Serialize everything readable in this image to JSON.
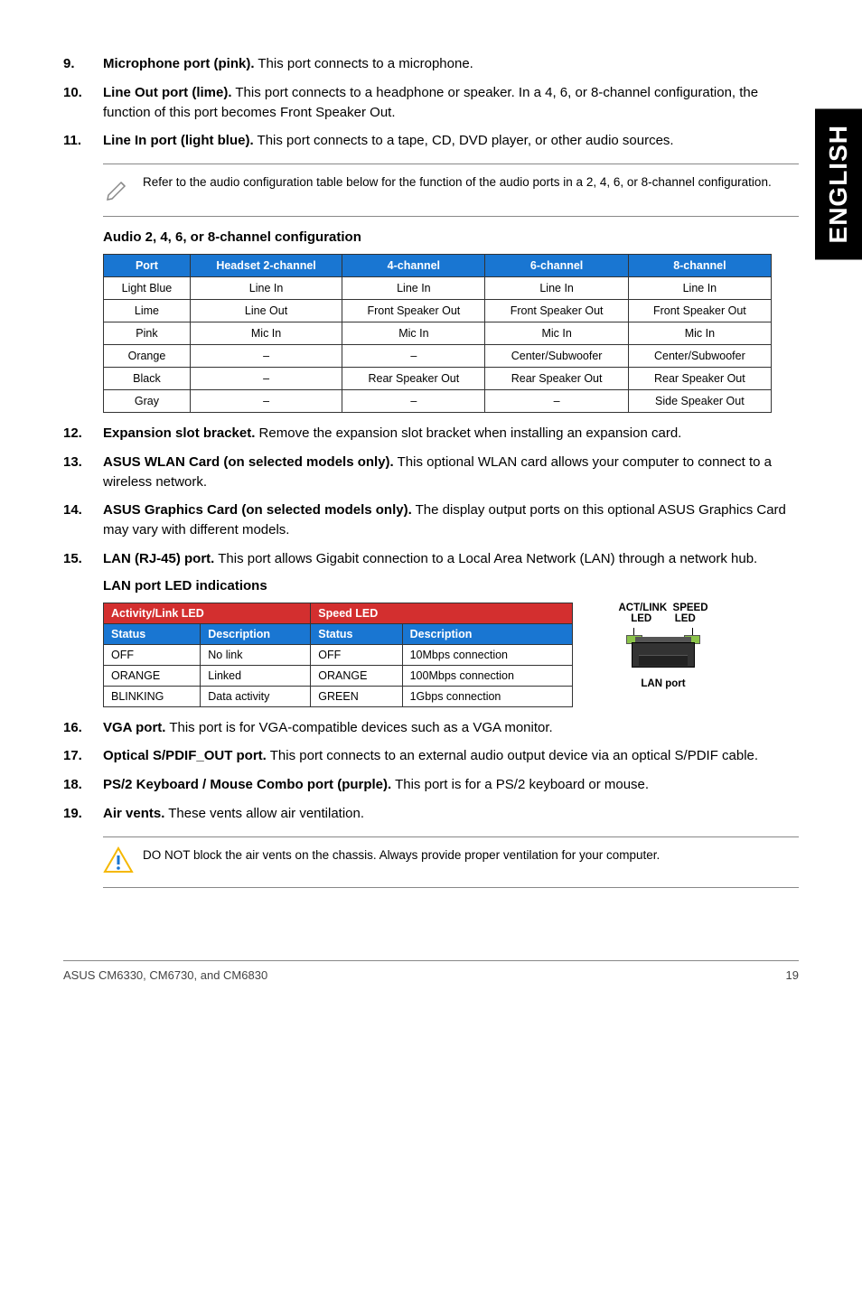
{
  "sideTab": "ENGLISH",
  "items9_11": [
    {
      "n": "9.",
      "bold": "Microphone port (pink).",
      "rest": " This port connects to a microphone."
    },
    {
      "n": "10.",
      "bold": "Line Out port (lime).",
      "rest": " This port connects to a headphone or speaker. In a 4, 6, or 8-channel configuration, the function of this port becomes Front Speaker Out."
    },
    {
      "n": "11.",
      "bold": "Line In port (light blue).",
      "rest": " This port connects to a tape, CD, DVD player, or other audio sources."
    }
  ],
  "note1": "Refer to the audio configuration table below for the function of the audio ports in a 2, 4, 6, or 8-channel configuration.",
  "audioHeading": "Audio 2, 4, 6, or 8-channel configuration",
  "audioHeaders": [
    "Port",
    "Headset 2-channel",
    "4-channel",
    "6-channel",
    "8-channel"
  ],
  "audioRows": [
    [
      "Light Blue",
      "Line In",
      "Line In",
      "Line In",
      "Line In"
    ],
    [
      "Lime",
      "Line Out",
      "Front Speaker Out",
      "Front Speaker Out",
      "Front Speaker Out"
    ],
    [
      "Pink",
      "Mic In",
      "Mic In",
      "Mic In",
      "Mic In"
    ],
    [
      "Orange",
      "–",
      "–",
      "Center/Subwoofer",
      "Center/Subwoofer"
    ],
    [
      "Black",
      "–",
      "Rear Speaker Out",
      "Rear Speaker Out",
      "Rear Speaker Out"
    ],
    [
      "Gray",
      "–",
      "–",
      "–",
      "Side Speaker Out"
    ]
  ],
  "items12_15": [
    {
      "n": "12.",
      "bold": "Expansion slot bracket.",
      "rest": " Remove the expansion slot bracket when installing an expansion card."
    },
    {
      "n": "13.",
      "bold": "ASUS WLAN Card (on selected models only).",
      "rest": " This optional WLAN card allows your computer to connect to a wireless network."
    },
    {
      "n": "14.",
      "bold": "ASUS Graphics Card (on selected models only).",
      "rest": " The display output ports on this optional ASUS Graphics Card may vary with different models."
    },
    {
      "n": "15.",
      "bold": "LAN (RJ-45) port.",
      "rest": " This port allows Gigabit connection to a Local Area Network (LAN) through a network hub."
    }
  ],
  "ledHeading": "LAN port LED indications",
  "ledHdr1": {
    "a": "Activity/Link LED",
    "b": "Speed LED"
  },
  "ledHdr2": [
    "Status",
    "Description",
    "Status",
    "Description"
  ],
  "ledRows": [
    [
      "OFF",
      "No link",
      "OFF",
      "10Mbps connection"
    ],
    [
      "ORANGE",
      "Linked",
      "ORANGE",
      "100Mbps connection"
    ],
    [
      "BLINKING",
      "Data activity",
      "GREEN",
      "1Gbps connection"
    ]
  ],
  "ledDiagram": {
    "top1": "ACT/LINK",
    "top2": "SPEED",
    "led": "LED",
    "bottom": "LAN port"
  },
  "items16_19": [
    {
      "n": "16.",
      "bold": "VGA port.",
      "rest": " This port is for VGA-compatible devices such as a VGA monitor."
    },
    {
      "n": "17.",
      "bold": "Optical S/PDIF_OUT port.",
      "rest": " This port connects to an external audio output device via an optical S/PDIF cable."
    },
    {
      "n": "18.",
      "bold": "PS/2 Keyboard / Mouse Combo port (purple).",
      "rest": " This port is for a PS/2 keyboard or mouse."
    },
    {
      "n": "19.",
      "bold": "Air vents.",
      "rest": " These vents allow air ventilation."
    }
  ],
  "warn": "DO NOT block the air vents on the chassis. Always provide proper ventilation for your computer.",
  "footer": {
    "left": "ASUS CM6330, CM6730, and CM6830",
    "right": "19"
  }
}
